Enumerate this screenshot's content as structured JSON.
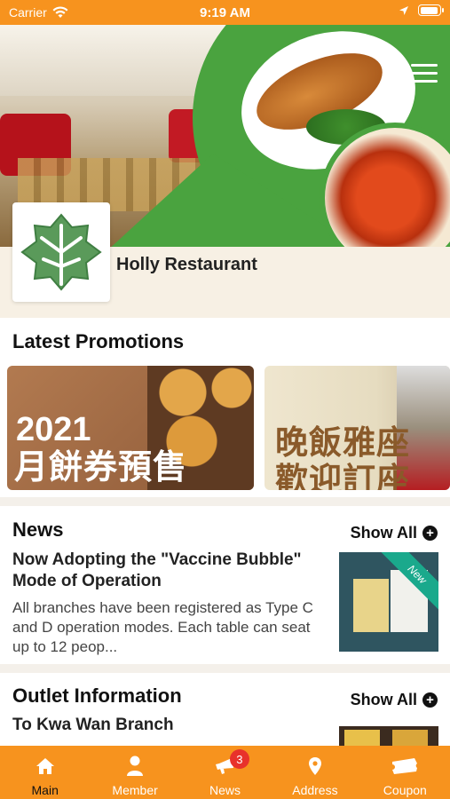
{
  "status_bar": {
    "carrier": "Carrier",
    "time": "9:19 AM",
    "battery_level": 0.95
  },
  "restaurant": {
    "name": "Holly Restaurant"
  },
  "promotions": {
    "title": "Latest Promotions",
    "items": [
      {
        "line1": "2021",
        "line2": "月餅券預售"
      },
      {
        "line1": "晚飯雅座",
        "line2": "歡迎訂座"
      }
    ]
  },
  "news": {
    "title": "News",
    "show_all_label": "Show All",
    "item": {
      "headline": "Now Adopting the \"Vaccine Bubble\" Mode of Operation",
      "summary": "All branches have been registered as Type C and D operation modes. Each table can seat up to 12 peop...",
      "tag": "New"
    }
  },
  "outlets": {
    "title": "Outlet Information",
    "show_all_label": "Show All",
    "item": {
      "name": "To Kwa Wan Branch"
    }
  },
  "tab_bar": {
    "active": "Main",
    "tabs": [
      {
        "label": "Main",
        "icon": "home-icon"
      },
      {
        "label": "Member",
        "icon": "person-icon"
      },
      {
        "label": "News",
        "icon": "megaphone-icon",
        "badge": "3"
      },
      {
        "label": "Address",
        "icon": "location-pin-icon"
      },
      {
        "label": "Coupon",
        "icon": "coupon-icon"
      }
    ]
  },
  "colors": {
    "accent": "#f7931e",
    "brand_green": "#4aa33f",
    "badge_red": "#e8322b"
  }
}
